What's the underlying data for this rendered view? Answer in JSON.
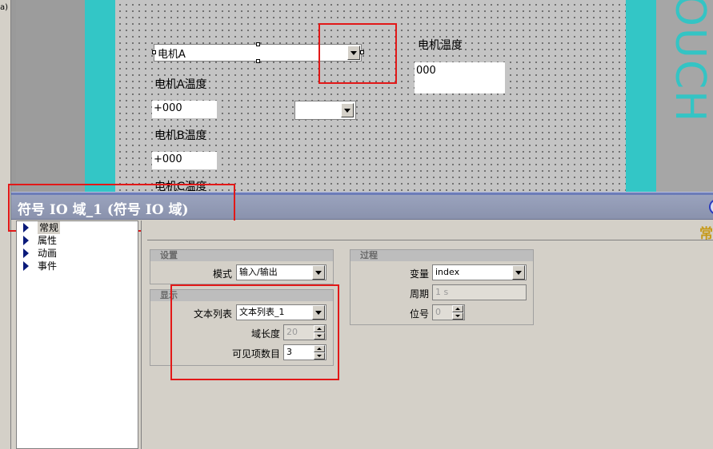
{
  "left_glyph": "a)",
  "canvas": {
    "brand_text": "OUCH",
    "symbol_combo_value": "电机A",
    "motor_temp_label": "电机温度",
    "motor_temp_value": "000",
    "motor_a_label": "电机A温度",
    "motor_a_value": "+000",
    "motor_b_label": "电机B温度",
    "motor_b_value": "+000",
    "motor_c_label": "电机C温度",
    "small_combo_value": ""
  },
  "properties": {
    "title": "符号 IO 域_1 (符号 IO 域)",
    "tab_glyph": "常",
    "tree": [
      {
        "label": "常规",
        "selected": true
      },
      {
        "label": "属性"
      },
      {
        "label": "动画"
      },
      {
        "label": "事件"
      }
    ],
    "settings": {
      "header": "设置",
      "mode_label": "模式",
      "mode_value": "输入/输出"
    },
    "display": {
      "header": "显示",
      "textlist_label": "文本列表",
      "textlist_value": "文本列表_1",
      "field_length_label": "域长度",
      "field_length_value": "20",
      "visible_items_label": "可见项数目",
      "visible_items_value": "3"
    },
    "process": {
      "header": "过程",
      "variable_label": "变量",
      "variable_value": "index",
      "cycle_label": "周期",
      "cycle_value": "1 s",
      "bit_label": "位号",
      "bit_value": "0"
    }
  },
  "colors": {
    "teal": "#33c6c6",
    "highlight_red": "#e21818",
    "header_bar": "#8a92ad"
  }
}
